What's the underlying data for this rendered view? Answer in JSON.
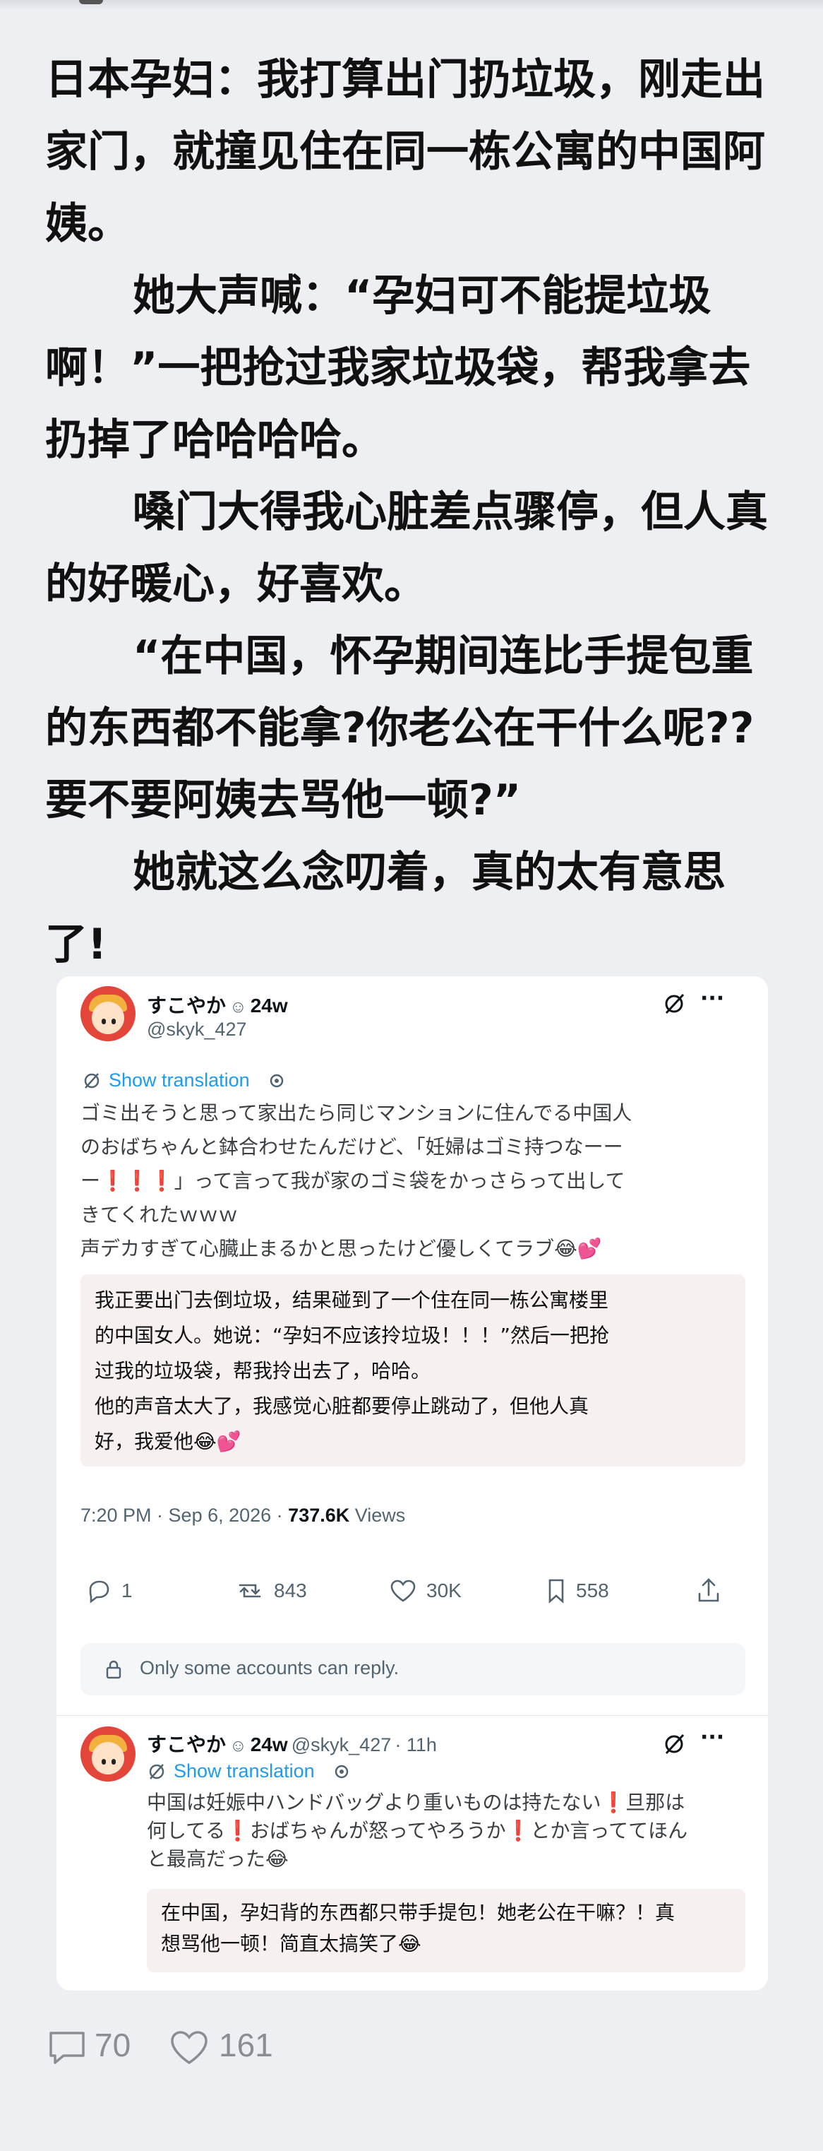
{
  "post": {
    "paragraphs": [
      "日本孕妇：我打算出门扔垃圾，刚走出家门，就撞见住在同一栋公寓的中国阿姨。",
      "她大声喊：“孕妇可不能提垃圾啊！”一把抢过我家垃圾袋，帮我拿去扔掉了哈哈哈哈。",
      "嗓门大得我心脏差点骤停，但人真的好暖心，好喜欢。",
      "“在中国，怀孕期间连比手提包重的东西都不能拿?你老公在干什么呢??要不要阿姨去骂他一顿?”",
      "她就这么念叨着，真的太有意思了!"
    ]
  },
  "tweet": {
    "display_name": "すこやか",
    "name_badge": "☺",
    "age": "24w",
    "handle": "@skyk_427",
    "more": "···",
    "show_translation": "Show translation",
    "jp_lines": [
      "ゴミ出そうと思って家出たら同じマンションに住んでる中国人",
      "のおばちゃんと鉢合わせたんだけど、「妊婦はゴミ持つなーー",
      "ー❗️❗️❗️」って言って我が家のゴミ袋をかっさらって出して",
      "きてくれたｗｗｗ",
      "声デカすぎて心臓止まるかと思ったけど優しくてラブ😂💕"
    ],
    "cn_lines": [
      "我正要出门去倒垃圾，结果碰到了一个住在同一栋公寓楼里",
      "的中国女人。她说：“孕妇不应该拎垃圾！！！”然后一把抢",
      "过我的垃圾袋，帮我拎出去了，哈哈。",
      "他的声音太大了，我感觉心脏都要停止跳动了，但他人真",
      "好，我爱他😂💕"
    ],
    "time": "7:20 PM · Sep 6, 2026 · ",
    "views_count": "737.6K",
    "views_label": " Views",
    "replies": "1",
    "retweets": "843",
    "likes": "30K",
    "bookmarks": "558",
    "reply_restriction": "Only some accounts can reply."
  },
  "reply": {
    "display_name": "すこやか",
    "name_badge": "☺",
    "age": "24w",
    "handle": "@skyk_427",
    "time_ago": "· 11h",
    "more": "···",
    "show_translation": "Show translation",
    "jp_lines": [
      "中国は妊娠中ハンドバッグより重いものは持たない❗️旦那は",
      "何してる❗️おばちゃんが怒ってやろうか❗️とか言っててほん",
      "と最高だった😂"
    ],
    "cn_lines": [
      "在中国，孕妇背的东西都只带手提包！她老公在干嘛？！真",
      "想骂他一顿！简直太搞笑了😂"
    ]
  },
  "footer": {
    "comments": "70",
    "likes": "161"
  },
  "colors": {
    "background": "#eeeff3",
    "link": "#1d9bf0",
    "muted": "#536471"
  }
}
